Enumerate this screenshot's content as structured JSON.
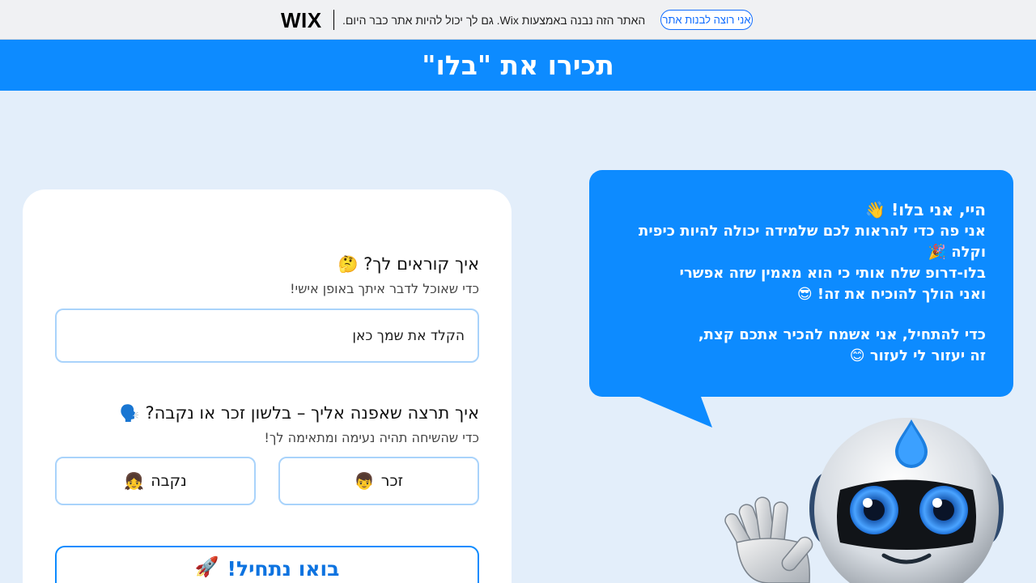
{
  "wix_banner": {
    "logo": "WIX",
    "text": "האתר הזה נבנה באמצעות Wix. גם לך יכול להיות אתר כבר היום.",
    "cta": "אני רוצה לבנות אתר"
  },
  "header": {
    "title": "תכירו את \"בלו\""
  },
  "bubble": {
    "title": "היי, אני בלו! 👋",
    "lines": [
      "אני פה כדי להראות לכם שלמידה יכולה להיות כיפית וקלה 🎉",
      "בלו-דרופ שלח אותי כי הוא מאמין שזה אפשרי",
      "ואני הולך להוכיח את זה! 😎",
      "כדי להתחיל, אני אשמח להכיר אתכם קצת,",
      "זה יעזור לי לעזור 😊"
    ]
  },
  "form": {
    "name_question": "איך קוראים לך?",
    "name_question_emoji": "🤔",
    "name_sub": "כדי שאוכל לדבר איתך באופן אישי!",
    "name_placeholder": "הקלד את שמך כאן",
    "gender_question": "איך תרצה שאפנה אליך – בלשון זכר או נקבה?",
    "gender_question_emoji": "🗣️",
    "gender_sub": "כדי שהשיחה תהיה נעימה ומתאימה לך!",
    "male_label": "זכר",
    "male_emoji": "👦",
    "female_label": "נקבה",
    "female_emoji": "👧",
    "start_label": "בואו נתחיל!",
    "start_emoji": "🚀"
  },
  "colors": {
    "primary": "#0d8bff",
    "background": "#e3eefa",
    "card": "#ffffff",
    "input_border": "#a9d3fb"
  }
}
